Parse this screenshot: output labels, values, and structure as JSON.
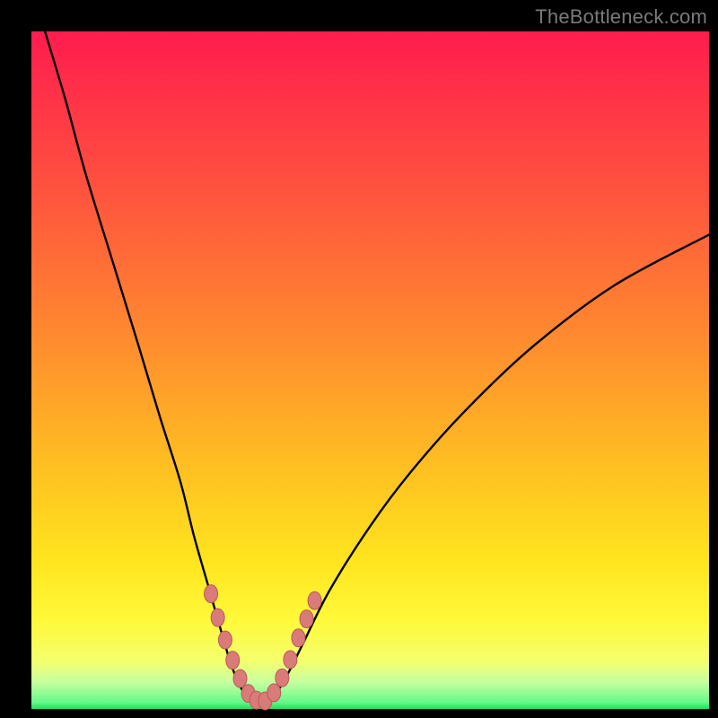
{
  "watermark": "TheBottleneck.com",
  "frame": {
    "outer_bg": "#000000",
    "plot_left": 35,
    "plot_top": 35,
    "plot_size": 755
  },
  "gradient_colors": {
    "c0": "#ff1c4e",
    "c1": "#ff4f3f",
    "c2": "#ff8a2f",
    "c3": "#ffbc22",
    "c4": "#ffe41e",
    "c5": "#fff93a",
    "c6": "#f3ff6e",
    "c7": "#c7ffa0",
    "c8": "#66f98b",
    "c9": "#18e05a"
  },
  "chart_data": {
    "type": "line",
    "title": "",
    "xlabel": "",
    "ylabel": "",
    "xlim": [
      0,
      100
    ],
    "ylim": [
      0,
      100
    ],
    "series": [
      {
        "name": "bottleneck-curve",
        "x": [
          2,
          5,
          8,
          12,
          16,
          19,
          22,
          24,
          26,
          28,
          29.5,
          31,
          32.5,
          34,
          36,
          38,
          40,
          44,
          50,
          56,
          64,
          74,
          86,
          100
        ],
        "y": [
          100,
          90,
          79,
          66,
          53,
          43,
          33.5,
          25.5,
          18.5,
          11.5,
          6.5,
          3,
          1.2,
          1,
          2.2,
          5.5,
          9.5,
          17.5,
          27,
          35,
          44,
          53.5,
          62.5,
          70
        ]
      }
    ],
    "markers": {
      "name": "highlight-dots",
      "x": [
        26.5,
        27.5,
        28.6,
        29.7,
        30.8,
        32.0,
        33.2,
        34.5,
        35.8,
        37.0,
        38.2,
        39.4,
        40.6,
        41.8
      ],
      "y": [
        17.0,
        13.5,
        10.2,
        7.2,
        4.5,
        2.3,
        1.3,
        1.2,
        2.4,
        4.6,
        7.3,
        10.5,
        13.3,
        16.0
      ]
    }
  }
}
